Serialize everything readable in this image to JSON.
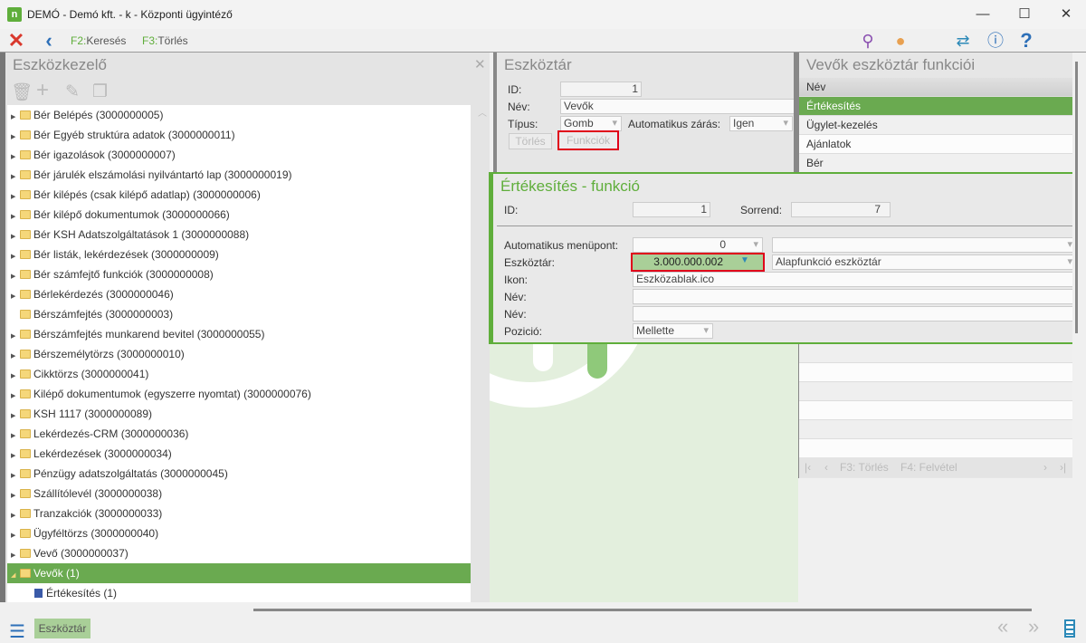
{
  "window": {
    "title": "DEMÓ - Demó kft. - k - Központi ügyintéző",
    "logo": "n",
    "min": "—",
    "max": "☐",
    "close": "✕"
  },
  "toolbar": {
    "f2_key": "F2:",
    "f2_label": "Keresés",
    "f3_key": "F3:",
    "f3_label": "Törlés"
  },
  "left": {
    "title": "Eszközkezelő",
    "items": [
      {
        "label": "Bér Belépés (3000000005)",
        "exp": true
      },
      {
        "label": "Bér Egyéb struktúra adatok (3000000011)",
        "exp": true
      },
      {
        "label": "Bér igazolások (3000000007)",
        "exp": true
      },
      {
        "label": "Bér járulék elszámolási nyilvántartó lap (3000000019)",
        "exp": true
      },
      {
        "label": "Bér kilépés (csak kilépő adatlap) (3000000006)",
        "exp": true
      },
      {
        "label": "Bér kilépő dokumentumok (3000000066)",
        "exp": true
      },
      {
        "label": "Bér KSH Adatszolgáltatások          1 (3000000088)",
        "exp": true
      },
      {
        "label": "Bér listák, lekérdezések (3000000009)",
        "exp": true
      },
      {
        "label": "Bér számfejtő funkciók (3000000008)",
        "exp": true
      },
      {
        "label": "Bérlekérdezés (3000000046)",
        "exp": true
      },
      {
        "label": "Bérszámfejtés (3000000003)",
        "exp": false
      },
      {
        "label": "Bérszámfejtés munkarend bevitel (3000000055)",
        "exp": true
      },
      {
        "label": "Bérszemélytörzs (3000000010)",
        "exp": true
      },
      {
        "label": "Cikktörzs (3000000041)",
        "exp": true
      },
      {
        "label": "Kilépő dokumentumok (egyszerre nyomtat) (3000000076)",
        "exp": true
      },
      {
        "label": "KSH 1117 (3000000089)",
        "exp": true
      },
      {
        "label": "Lekérdezés-CRM (3000000036)",
        "exp": true
      },
      {
        "label": "Lekérdezések (3000000034)",
        "exp": true
      },
      {
        "label": "Pénzügy adatszolgáltatás (3000000045)",
        "exp": true
      },
      {
        "label": "Szállítólevél (3000000038)",
        "exp": true
      },
      {
        "label": "Tranzakciók (3000000033)",
        "exp": true
      },
      {
        "label": "Ügyféltörzs (3000000040)",
        "exp": true
      },
      {
        "label": "Vevő (3000000037)",
        "exp": true
      }
    ],
    "selected": "Vevők (1)",
    "child": "Értékesítés (1)"
  },
  "eszkoztar": {
    "title": "Eszköztár",
    "id_label": "ID:",
    "id": "1",
    "nev_label": "Név:",
    "nev": "Vevők",
    "tipus_label": "Típus:",
    "tipus": "Gomb",
    "auto_label": "Automatikus zárás:",
    "auto": "Igen",
    "torles": "Törlés",
    "funkciok": "Funkciók"
  },
  "functions": {
    "title": "Vevők eszköztár funkciói",
    "header": "Név",
    "rows": [
      "Értékesítés",
      "Ügylet-kezelés",
      "Ajánlatok",
      "Bér"
    ],
    "pager_torles": "F3: Törlés",
    "pager_felvetel": "F4: Felvétel"
  },
  "popup": {
    "title": "Értékesítés - funkció",
    "id_label": "ID:",
    "id": "1",
    "sorrend_label": "Sorrend:",
    "sorrend": "7",
    "auto_label": "Automatikus menüpont:",
    "auto": "0",
    "eszk_label": "Eszköztár:",
    "eszk": "3.000.000.002",
    "eszk_name": "Alapfunkció eszköztár",
    "ikon_label": "Ikon:",
    "ikon": "Eszközablak.ico",
    "nev1_label": "Név:",
    "nev2_label": "Név:",
    "poz_label": "Pozició:",
    "poz": "Mellette"
  },
  "bottom": {
    "tab": "Eszköztár"
  },
  "colors": {
    "accent": "#5fae3b",
    "selected": "#6aaa50",
    "highlight": "#e0001a"
  }
}
